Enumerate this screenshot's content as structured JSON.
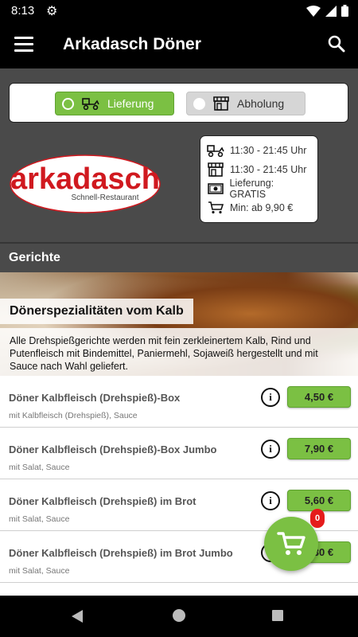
{
  "status_bar": {
    "time": "8:13"
  },
  "app_bar": {
    "title": "Arkadasch Döner"
  },
  "mode": {
    "delivery_label": "Lieferung",
    "pickup_label": "Abholung",
    "selected": "delivery"
  },
  "logo": {
    "text": "arkadasch",
    "subtitle": "Schnell-Restaurant"
  },
  "info": {
    "delivery_hours": "11:30 - 21:45 Uhr",
    "pickup_hours": "11:30 - 21:45 Uhr",
    "delivery_fee": "Lieferung: GRATIS",
    "min_order": "Min: ab 9,90 €"
  },
  "section": {
    "title": "Gerichte"
  },
  "category": {
    "title": "Dönerspezialitäten vom Kalb",
    "description": "Alle Drehspießgerichte werden mit fein zerkleinertem Kalb, Rind und Putenfleisch mit Bindemittel, Paniermehl, Sojaweiß hergestellt und mit Sauce nach Wahl geliefert."
  },
  "items": [
    {
      "name": "Döner Kalbfleisch (Drehspieß)-Box",
      "sub": "mit Kalbfleisch (Drehspieß), Sauce",
      "price": "4,50 €"
    },
    {
      "name": "Döner Kalbfleisch (Drehspieß)-Box Jumbo",
      "sub": "mit Salat, Sauce",
      "price": "7,90 €"
    },
    {
      "name": "Döner Kalbfleisch (Drehspieß) im Brot",
      "sub": "mit Salat, Sauce",
      "price": "5,60 €"
    },
    {
      "name": "Döner Kalbfleisch (Drehspieß) im Brot Jumbo",
      "sub": "mit Salat, Sauce",
      "price": "8,30 €"
    }
  ],
  "cart": {
    "count": "0"
  },
  "colors": {
    "accent": "#7bc043",
    "badge": "#e51b1b",
    "logo_red": "#d0191f"
  }
}
